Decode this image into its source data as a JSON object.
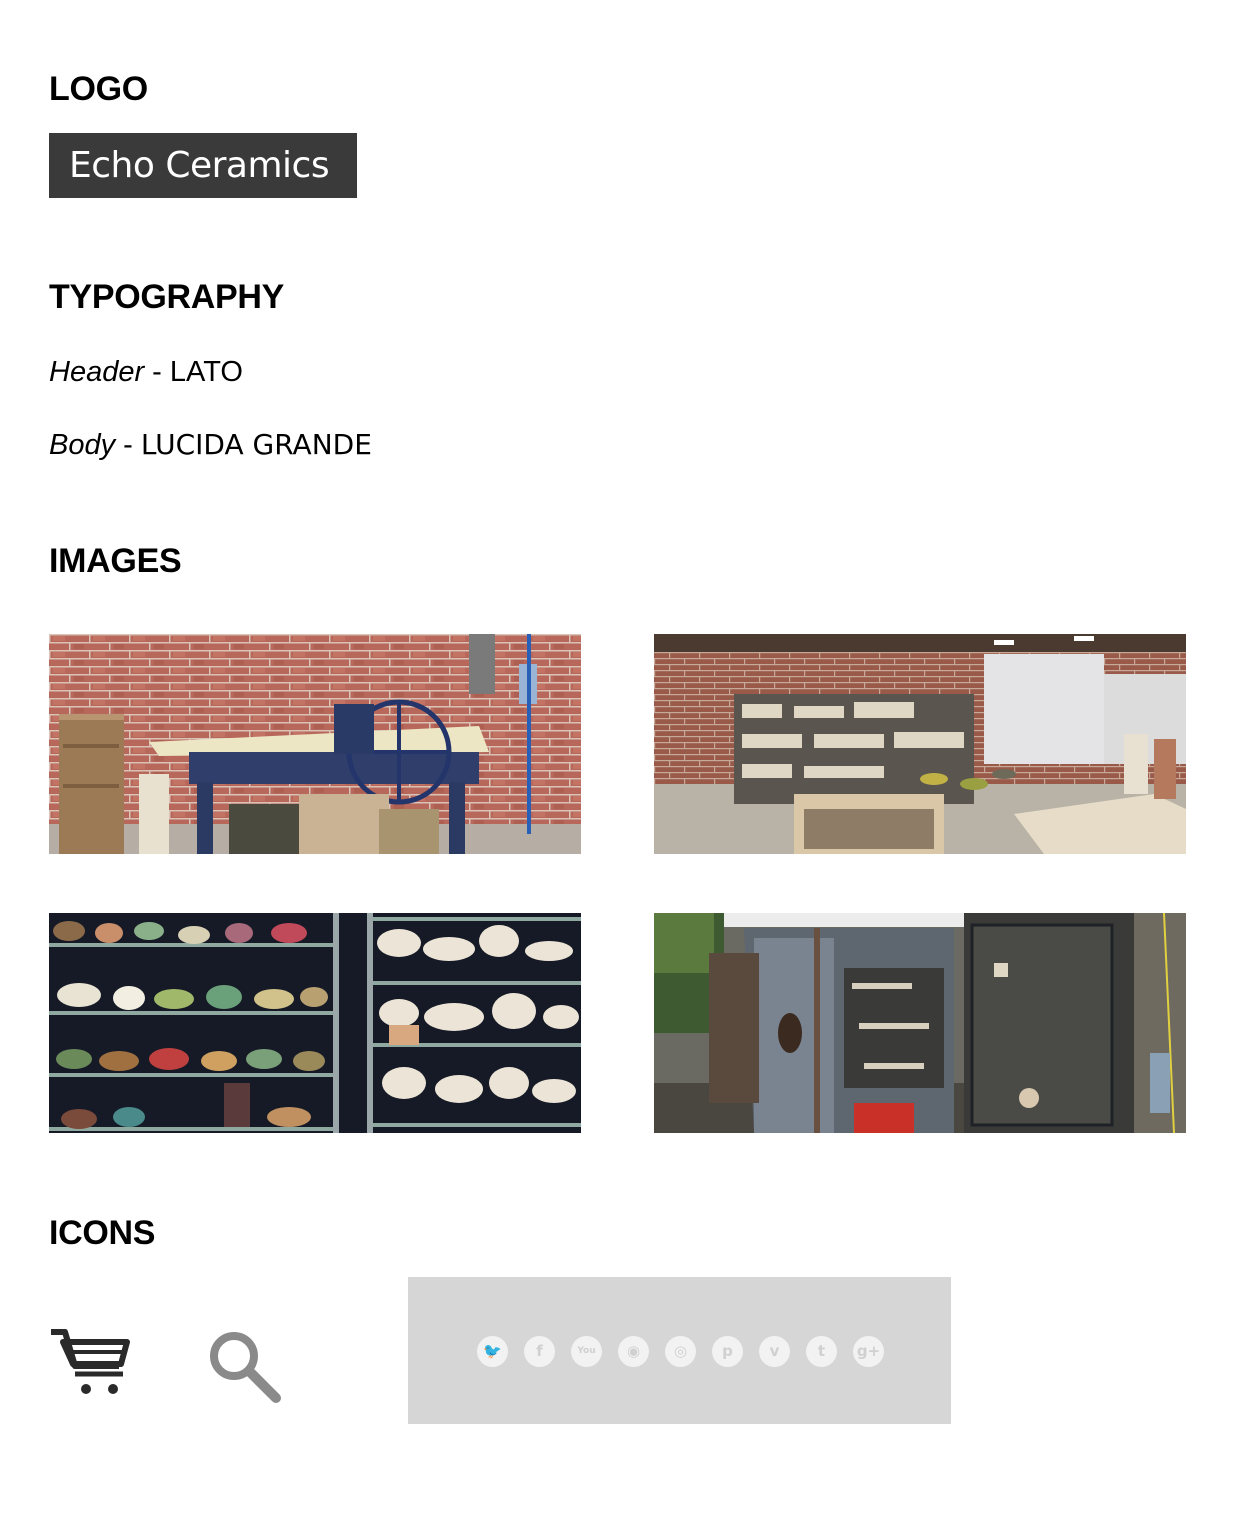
{
  "sections": {
    "logo": "LOGO",
    "typography": "TYPOGRAPHY",
    "images": "IMAGES",
    "icons": "ICONS"
  },
  "logo": {
    "text": "Echo Ceramics"
  },
  "typography": {
    "header": {
      "kind": "Header",
      "separator": " - ",
      "font": "LATO"
    },
    "body": {
      "kind": "Body",
      "separator": " - ",
      "font": "LUCIDA GRANDE"
    }
  },
  "images": [
    {
      "name": "photo-studio-wheel",
      "subject": "pottery wheel against brick wall"
    },
    {
      "name": "photo-studio-interior",
      "subject": "ceramics studio interior with shelves and tables"
    },
    {
      "name": "photo-pottery-shelves",
      "subject": "shelves of glazed and unglazed pottery"
    },
    {
      "name": "photo-kilns",
      "subject": "outdoor kilns"
    }
  ],
  "icons": {
    "cart": "cart-icon",
    "search": "search-icon",
    "social": [
      {
        "name": "twitter-icon",
        "glyph": "🐦"
      },
      {
        "name": "facebook-icon",
        "glyph": "f"
      },
      {
        "name": "youtube-icon",
        "glyph": "You"
      },
      {
        "name": "rss-icon",
        "glyph": "◉"
      },
      {
        "name": "instagram-icon",
        "glyph": "◎"
      },
      {
        "name": "pinterest-icon",
        "glyph": "p"
      },
      {
        "name": "vimeo-icon",
        "glyph": "v"
      },
      {
        "name": "tumblr-icon",
        "glyph": "t"
      },
      {
        "name": "google-plus-icon",
        "glyph": "g+"
      }
    ]
  },
  "colors": {
    "logo_background": "#3a3a3a",
    "logo_text": "#ffffff",
    "social_panel": "#d6d6d6",
    "social_icon": "#f2f2f2"
  }
}
